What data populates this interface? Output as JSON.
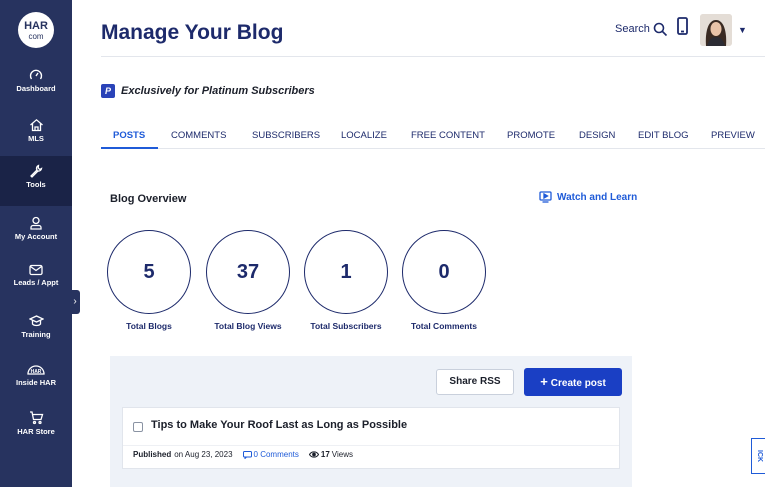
{
  "logo": {
    "line1": "HAR",
    "line2": "com"
  },
  "sidebar": {
    "items": [
      {
        "label": "Dashboard",
        "icon": "gauge-icon"
      },
      {
        "label": "MLS",
        "icon": "house-icon"
      },
      {
        "label": "Tools",
        "icon": "wrench-icon"
      },
      {
        "label": "My Account",
        "icon": "person-icon"
      },
      {
        "label": "Leads / Appt",
        "icon": "envelope-icon"
      },
      {
        "label": "Training",
        "icon": "graduation-cap-icon"
      },
      {
        "label": "Inside HAR",
        "icon": "har-badge-icon"
      },
      {
        "label": "HAR Store",
        "icon": "cart-icon"
      }
    ],
    "collapse_glyph": "›"
  },
  "header": {
    "title": "Manage Your Blog",
    "search_label": "Search"
  },
  "banner": {
    "badge": "P",
    "text": "Exclusively for Platinum Subscribers"
  },
  "tabs": [
    {
      "label": "POSTS",
      "active": true
    },
    {
      "label": "COMMENTS"
    },
    {
      "label": "SUBSCRIBERS"
    },
    {
      "label": "LOCALIZE"
    },
    {
      "label": "FREE CONTENT"
    },
    {
      "label": "PROMOTE"
    },
    {
      "label": "DESIGN"
    },
    {
      "label": "EDIT BLOG"
    },
    {
      "label": "PREVIEW"
    }
  ],
  "overview": {
    "title": "Blog Overview",
    "watch_label": "Watch and Learn",
    "stats": [
      {
        "value": "5",
        "label": "Total Blogs"
      },
      {
        "value": "37",
        "label": "Total Blog Views"
      },
      {
        "value": "1",
        "label": "Total Subscribers"
      },
      {
        "value": "0",
        "label": "Total Comments"
      }
    ]
  },
  "posts": {
    "share_label": "Share RSS",
    "create_label": "Create post",
    "items": [
      {
        "title": "Tips to Make Your Roof Last as Long as Possible",
        "published_label": "Published",
        "published_on": "on Aug 23, 2023",
        "comments": "0 Comments",
        "views_count": "17",
        "views_label": "Views"
      }
    ]
  },
  "feedback_label": "ICK",
  "colors": {
    "sidebar": "#27335f",
    "sidebar_active": "#1a2347",
    "title": "#1d2a6b",
    "accent": "#1f5bd8",
    "primary_button": "#1a3fc4",
    "panel": "#eef2f8"
  }
}
